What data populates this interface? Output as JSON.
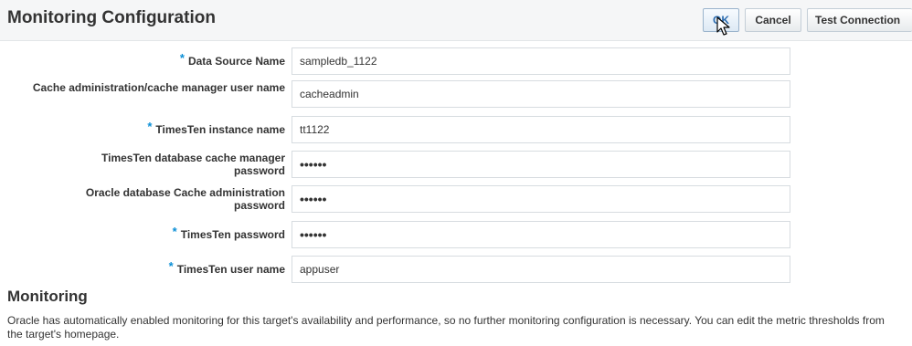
{
  "header": {
    "title": "Monitoring Configuration",
    "buttons": {
      "ok": "OK",
      "cancel": "Cancel",
      "test_connection": "Test Connection"
    }
  },
  "form": {
    "fields": [
      {
        "label": "Data Source Name",
        "required": true,
        "value": "sampledb_1122",
        "type": "text"
      },
      {
        "label": "Cache administration/cache manager user name",
        "required": false,
        "value": "cacheadmin",
        "type": "text"
      },
      {
        "label": "TimesTen instance name",
        "required": true,
        "value": "tt1122",
        "type": "text"
      },
      {
        "label": "TimesTen database cache manager password",
        "required": false,
        "value": "••••••",
        "type": "password"
      },
      {
        "label": "Oracle database Cache administration password",
        "required": false,
        "value": "••••••",
        "type": "password"
      },
      {
        "label": "TimesTen password",
        "required": true,
        "value": "••••••",
        "type": "password"
      },
      {
        "label": "TimesTen user name",
        "required": true,
        "value": "appuser",
        "type": "text"
      }
    ],
    "required_marker": "*"
  },
  "monitoring": {
    "title": "Monitoring",
    "text": "Oracle has automatically enabled monitoring for this target's availability and performance, so no further monitoring configuration is necessary. You can edit the metric thresholds from the target's homepage."
  },
  "colors": {
    "required_marker": "#0b8fd6",
    "header_background": "#f5f6f7",
    "ok_text": "#2b6cb0"
  }
}
